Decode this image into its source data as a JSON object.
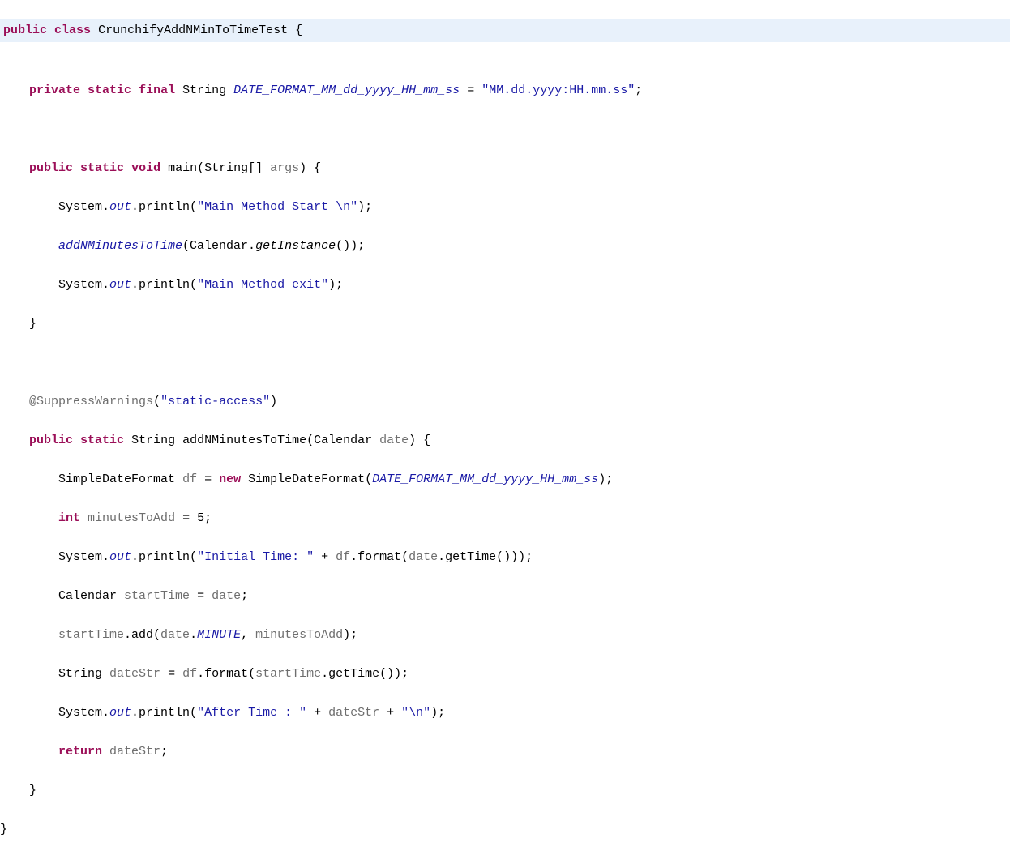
{
  "line1": {
    "kw_public": "public",
    "kw_class": "class",
    "classname": "CrunchifyAddNMinToTimeTest",
    "brace": "{"
  },
  "line3": {
    "kw_private": "private",
    "kw_static": "static",
    "kw_final": "final",
    "type": "String",
    "fieldname": "DATE_FORMAT_MM_dd_yyyy_HH_mm_ss",
    "eq": "=",
    "value": "\"MM.dd.yyyy:HH.mm.ss\"",
    "semi": ";"
  },
  "line5": {
    "kw_public": "public",
    "kw_static": "static",
    "kw_void": "void",
    "method": "main",
    "params": "(String[] ",
    "param_args": "args",
    "params_close": ") {"
  },
  "line6": {
    "system": "System.",
    "out": "out",
    "println": ".println(",
    "str": "\"Main Method Start \\n\"",
    "close": ");"
  },
  "line7": {
    "method": "addNMinutesToTime",
    "open": "(Calendar.",
    "getinstance": "getInstance",
    "close": "());"
  },
  "line8": {
    "system": "System.",
    "out": "out",
    "println": ".println(",
    "str": "\"Main Method exit\"",
    "close": ");"
  },
  "line9": {
    "brace": "}"
  },
  "line11": {
    "annotation": "@SuppressWarnings",
    "open": "(",
    "str": "\"static-access\"",
    "close": ")"
  },
  "line12": {
    "kw_public": "public",
    "kw_static": "static",
    "type": "String",
    "method": "addNMinutesToTime",
    "params": "(Calendar ",
    "param_date": "date",
    "params_close": ") {"
  },
  "line13": {
    "type": "SimpleDateFormat",
    "var": "df",
    "eq": " = ",
    "kw_new": "new",
    "ctor": " SimpleDateFormat(",
    "arg": "DATE_FORMAT_MM_dd_yyyy_HH_mm_ss",
    "close": ");"
  },
  "line14": {
    "kw_int": "int",
    "var": "minutesToAdd",
    "rest": " = 5;"
  },
  "line15": {
    "system": "System.",
    "out": "out",
    "println": ".println(",
    "str": "\"Initial Time: \"",
    "plus": " + ",
    "df": "df",
    "rest": ".format(",
    "date": "date",
    "rest2": ".getTime()));"
  },
  "line16": {
    "type": "Calendar",
    "var": "startTime",
    "eq": " = ",
    "date": "date",
    "semi": ";"
  },
  "line17": {
    "startTime": "startTime",
    "add": ".add(",
    "date": "date",
    "dot": ".",
    "minute": "MINUTE",
    "comma": ", ",
    "mta": "minutesToAdd",
    "close": ");"
  },
  "line18": {
    "type": "String",
    "var": "dateStr",
    "eq": " = ",
    "df": "df",
    "rest": ".format(",
    "startTime": "startTime",
    "rest2": ".getTime());"
  },
  "line19": {
    "system": "System.",
    "out": "out",
    "println": ".println(",
    "str": "\"After Time : \"",
    "plus1": " + ",
    "dateStr": "dateStr",
    "plus2": " + ",
    "nl": "\"\\n\"",
    "close": ");"
  },
  "line20": {
    "kw_return": "return",
    "var": "dateStr",
    "semi": ";"
  },
  "line21": {
    "brace": "}"
  },
  "line22": {
    "brace": "}"
  }
}
